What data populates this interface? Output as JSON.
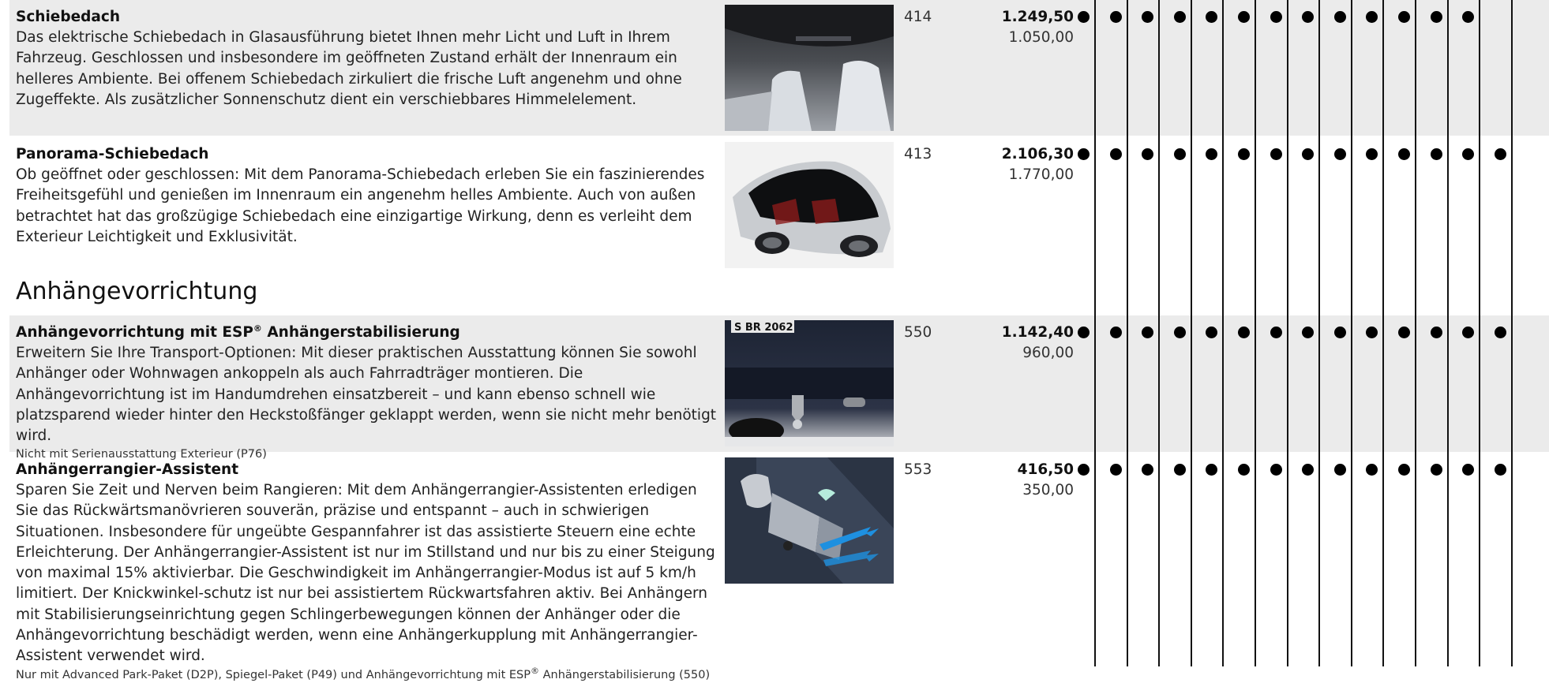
{
  "section_heading": "Anhängevorrichtung",
  "items": [
    {
      "title": "Schiebedach",
      "description": "Das elektrische Schiebedach in Glasausführung bietet Ihnen mehr Licht und Luft in Ihrem Fahrzeug. Geschlossen und insbesondere im geöffneten Zustand erhält der Innenraum ein helleres Ambiente. Bei offenem Schiebedach zirkuliert die frische Luft angenehm und ohne Zugeffekte. Als zusätzlicher Sonnenschutz dient ein verschiebbares Himmelelement.",
      "note": "",
      "code": "414",
      "price_gross": "1.249,50",
      "price_net": "1.050,00",
      "image": "interior-sunroof-photo",
      "availability": [
        true,
        true,
        true,
        true,
        true,
        true,
        true,
        true,
        true,
        true,
        true,
        true,
        true,
        false
      ]
    },
    {
      "title": "Panorama-Schiebedach",
      "description": "Ob geöffnet oder geschlossen: Mit dem Panorama-Schiebedach erleben Sie ein faszinierendes Freiheitsgefühl und genießen im Innenraum ein angenehm helles Ambiente. Auch von außen betrachtet hat das großzügige Schiebedach eine einzigartige Wirkung, denn es verleiht dem Exterieur Leichtigkeit und Exklusivität.",
      "note": "",
      "code": "413",
      "price_gross": "2.106,30",
      "price_net": "1.770,00",
      "image": "panorama-roof-photo",
      "availability": [
        true,
        true,
        true,
        true,
        true,
        true,
        true,
        true,
        true,
        true,
        true,
        true,
        true,
        true
      ]
    },
    {
      "title_main": "Anhängevorrichtung mit ESP",
      "title_sup": "®",
      "title_rest": " Anhängerstabilisierung",
      "description": "Erweitern Sie Ihre Transport-Optionen: Mit dieser praktischen Ausstattung können Sie sowohl Anhänger oder Wohnwagen ankoppeln als auch Fahrradträger montieren. Die Anhängevorrichtung ist im Handumdrehen einsatzbereit – und kann ebenso schnell wie platzsparend wieder hinter den Heckstoßfänger geklappt werden, wenn sie nicht mehr benötigt wird.",
      "note": "Nicht mit Serienausstattung Exterieur (P76)",
      "code": "550",
      "price_gross": "1.142,40",
      "price_net": "960,00",
      "image": "tow-hitch-photo",
      "plate_text": "S BR 2062",
      "availability": [
        true,
        true,
        true,
        true,
        true,
        true,
        true,
        true,
        true,
        true,
        true,
        true,
        true,
        true
      ]
    },
    {
      "title": "Anhängerrangier-Assistent",
      "description": "Sparen Sie Zeit und Nerven beim Rangieren: Mit dem Anhängerrangier-Assistenten erledigen Sie das Rückwärtsmanövrieren souverän, präzise und entspannt – auch in schwierigen Situationen. Insbesondere für ungeübte Gespannfahrer ist das assistierte Steuern eine echte Erleichterung. Der Anhängerrangier-Assistent ist nur im Stillstand und nur bis zu einer Steigung von maximal 15% aktivierbar. Die Geschwindigkeit im Anhängerrangier-Modus ist auf 5 km/h limitiert. Der Knickwinkel-schutz ist nur bei assistiertem Rückwartsfahren aktiv. Bei Anhängern mit Stabilisierungseinrichtung gegen Schlingerbewegungen können der Anhänger oder die Anhängevorrichtung beschädigt werden, wenn eine Anhängerkupplung mit Anhängerrangier-Assistent verwendet wird.",
      "note_main": "Nur mit Advanced Park-Paket (D2P), Spiegel-Paket (P49) und Anhängevorrichtung mit ESP",
      "note_sup": "®",
      "note_rest": " Anhängerstabilisierung (550)",
      "code": "553",
      "price_gross": "416,50",
      "price_net": "350,00",
      "image": "trailer-assist-illustration",
      "availability": [
        true,
        true,
        true,
        true,
        true,
        true,
        true,
        true,
        true,
        true,
        true,
        true,
        true,
        true
      ]
    }
  ],
  "colors": {
    "row_band": "#ebebeb",
    "dot": "#000000",
    "rule": "#111111",
    "text": "#1a1a1a"
  }
}
